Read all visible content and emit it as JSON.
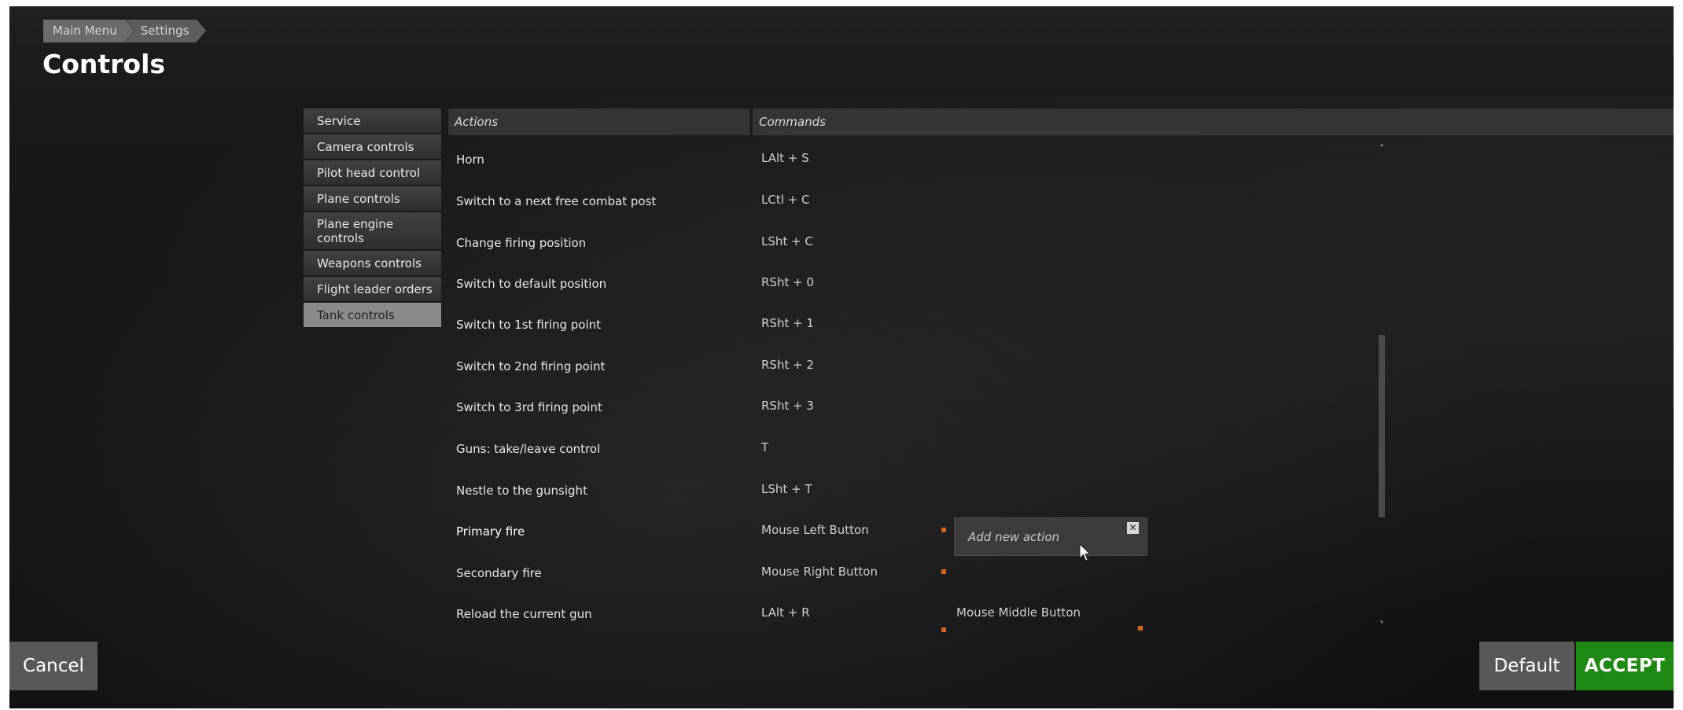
{
  "breadcrumb": [
    "Main Menu",
    "Settings"
  ],
  "page_title": "Controls",
  "categories": [
    {
      "label": "Service",
      "active": false
    },
    {
      "label": "Camera controls",
      "active": false
    },
    {
      "label": "Pilot head control",
      "active": false
    },
    {
      "label": "Plane controls",
      "active": false
    },
    {
      "label": "Plane engine controls",
      "active": false
    },
    {
      "label": "Weapons controls",
      "active": false
    },
    {
      "label": "Flight leader orders",
      "active": false
    },
    {
      "label": "Tank controls",
      "active": true
    }
  ],
  "table": {
    "actions_header": "Actions",
    "commands_header": "Commands",
    "rows": [
      {
        "action": "Horn",
        "command1": "LAlt + S",
        "command2": ""
      },
      {
        "action": "Switch to a next free combat post",
        "command1": "LCtl + C",
        "command2": ""
      },
      {
        "action": "Change firing position",
        "command1": "LSht + C",
        "command2": ""
      },
      {
        "action": "Switch to default position",
        "command1": "RSht + 0",
        "command2": ""
      },
      {
        "action": "Switch to 1st firing point",
        "command1": "RSht + 1",
        "command2": ""
      },
      {
        "action": "Switch to 2nd firing point",
        "command1": "RSht + 2",
        "command2": ""
      },
      {
        "action": "Switch to 3rd firing point",
        "command1": "RSht + 3",
        "command2": ""
      },
      {
        "action": "Guns: take/leave control",
        "command1": "T",
        "command2": ""
      },
      {
        "action": "Nestle to the gunsight",
        "command1": "LSht + T",
        "command2": ""
      },
      {
        "action": "Primary fire",
        "command1": "Mouse Left Button",
        "command2": ""
      },
      {
        "action": "Secondary fire",
        "command1": "Mouse Right Button",
        "command2": ""
      },
      {
        "action": "Reload the current gun",
        "command1": "LAlt + R",
        "command2": "Mouse Middle Button"
      }
    ]
  },
  "popup": {
    "label": "Add new action",
    "close_glyph": "✕"
  },
  "scroll": {
    "up_glyph": "˄",
    "down_glyph": "˅"
  },
  "buttons": {
    "cancel": "Cancel",
    "default": "Default",
    "accept": "ACCEPT"
  },
  "colors": {
    "accent_green": "#1f8a13",
    "orange_marker": "#d2631f"
  }
}
